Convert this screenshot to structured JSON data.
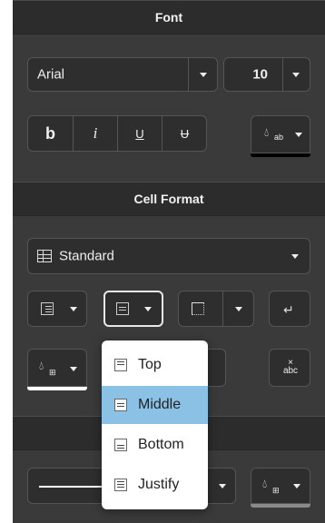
{
  "font_section": {
    "title": "Font",
    "font_family": "Arial",
    "font_size": "10",
    "bold_label": "b",
    "italic_label": "i",
    "underline_label": "U",
    "strike_label": "̶U",
    "text_color_button": {
      "icon": "text-color-icon",
      "sub": "ab",
      "swatch_color": "#000000"
    }
  },
  "cell_format_section": {
    "title": "Cell Format",
    "number_format": "Standard",
    "fill_swatch_color": "#ffffff"
  },
  "valign_menu": {
    "items": [
      {
        "label": "Top",
        "selected": false
      },
      {
        "label": "Middle",
        "selected": true
      },
      {
        "label": "Bottom",
        "selected": false
      },
      {
        "label": "Justify",
        "selected": false
      }
    ]
  },
  "border_section": {
    "title": "",
    "border_color_swatch": "#ffffff"
  },
  "colors": {
    "panel_bg": "#3a3a3a",
    "header_bg": "#2c2c2c",
    "menu_selected": "#8cc1e6"
  }
}
